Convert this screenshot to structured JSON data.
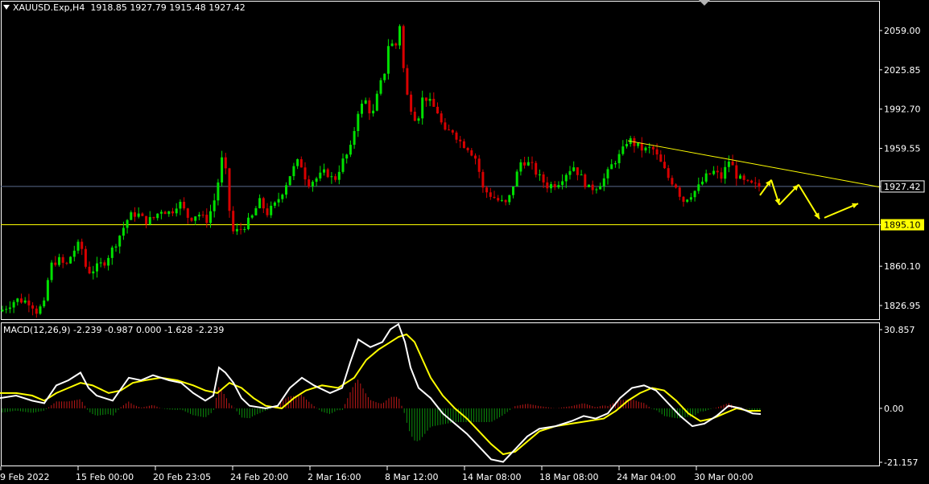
{
  "header": {
    "symbol": "XAUUSD.Exp,H4",
    "ohlc": "1918.85 1927.79 1915.48 1927.42"
  },
  "macd_header": {
    "label": "MACD(12,26,9) -2.239 -0.987 0.000 -1.628 -2.239"
  },
  "colors": {
    "background": "#000000",
    "bull_candle": "#00e000",
    "bear_candle": "#d80000",
    "macd_line": "#ffffff",
    "signal_line": "#ffff00",
    "histogram_up": "#c01818",
    "histogram_down": "#0c900c",
    "annotation": "#ffff00",
    "current_price_line": "#5a6a8c",
    "grid_frame": "#ffffff"
  },
  "chart_data": [
    {
      "type": "candlestick",
      "instrument": "XAUUSD.Exp",
      "timeframe": "H4",
      "ylim": [
        1800,
        2080
      ],
      "y_ticks": [
        "2059.00",
        "2025.85",
        "1992.70",
        "1959.55",
        "1927.42",
        "1895.10",
        "1860.10",
        "1826.95"
      ],
      "current_price": 1927.42,
      "support_level": 1895.1,
      "x_ticks": [
        "9 Feb 2022",
        "15 Feb 00:00",
        "20 Feb 23:05",
        "24 Feb 20:00",
        "2 Mar 16:00",
        "8 Mar 12:00",
        "14 Mar 08:00",
        "18 Mar 08:00",
        "24 Mar 04:00",
        "30 Mar 00:00"
      ],
      "close_path": [
        [
          0,
          1822
        ],
        [
          20,
          1832
        ],
        [
          38,
          1830
        ],
        [
          45,
          1822
        ],
        [
          55,
          1828
        ],
        [
          62,
          1860
        ],
        [
          72,
          1866
        ],
        [
          82,
          1860
        ],
        [
          90,
          1872
        ],
        [
          100,
          1880
        ],
        [
          108,
          1855
        ],
        [
          118,
          1858
        ],
        [
          130,
          1864
        ],
        [
          140,
          1875
        ],
        [
          150,
          1888
        ],
        [
          160,
          1902
        ],
        [
          170,
          1905
        ],
        [
          180,
          1898
        ],
        [
          190,
          1900
        ],
        [
          200,
          1908
        ],
        [
          212,
          1905
        ],
        [
          222,
          1915
        ],
        [
          235,
          1900
        ],
        [
          246,
          1905
        ],
        [
          256,
          1898
        ],
        [
          265,
          1912
        ],
        [
          272,
          1935
        ],
        [
          278,
          1960
        ],
        [
          283,
          1915
        ],
        [
          290,
          1888
        ],
        [
          300,
          1892
        ],
        [
          312,
          1900
        ],
        [
          322,
          1915
        ],
        [
          332,
          1905
        ],
        [
          342,
          1912
        ],
        [
          352,
          1925
        ],
        [
          362,
          1940
        ],
        [
          372,
          1950
        ],
        [
          382,
          1930
        ],
        [
          395,
          1935
        ],
        [
          405,
          1940
        ],
        [
          415,
          1932
        ],
        [
          425,
          1948
        ],
        [
          435,
          1958
        ],
        [
          445,
          1992
        ],
        [
          455,
          2000
        ],
        [
          462,
          1985
        ],
        [
          470,
          2008
        ],
        [
          478,
          2025
        ],
        [
          484,
          2055
        ],
        [
          490,
          2040
        ],
        [
          497,
          2066
        ],
        [
          503,
          2010
        ],
        [
          510,
          1995
        ],
        [
          518,
          1982
        ],
        [
          526,
          2005
        ],
        [
          534,
          1998
        ],
        [
          544,
          1990
        ],
        [
          552,
          1972
        ],
        [
          562,
          1975
        ],
        [
          572,
          1965
        ],
        [
          582,
          1960
        ],
        [
          592,
          1950
        ],
        [
          600,
          1925
        ],
        [
          610,
          1920
        ],
        [
          620,
          1915
        ],
        [
          630,
          1912
        ],
        [
          638,
          1930
        ],
        [
          648,
          1950
        ],
        [
          660,
          1945
        ],
        [
          670,
          1935
        ],
        [
          680,
          1928
        ],
        [
          692,
          1930
        ],
        [
          702,
          1938
        ],
        [
          712,
          1945
        ],
        [
          722,
          1935
        ],
        [
          732,
          1925
        ],
        [
          742,
          1928
        ],
        [
          752,
          1935
        ],
        [
          762,
          1948
        ],
        [
          772,
          1955
        ],
        [
          780,
          1968
        ],
        [
          790,
          1962
        ],
        [
          800,
          1958
        ],
        [
          810,
          1960
        ],
        [
          820,
          1948
        ],
        [
          830,
          1935
        ],
        [
          840,
          1928
        ],
        [
          848,
          1915
        ],
        [
          856,
          1920
        ],
        [
          866,
          1925
        ],
        [
          876,
          1935
        ],
        [
          886,
          1940
        ],
        [
          896,
          1935
        ],
        [
          906,
          1950
        ],
        [
          916,
          1935
        ],
        [
          926,
          1930
        ],
        [
          936,
          1928
        ],
        [
          944,
          1927.42
        ]
      ],
      "annotations": {
        "descending_trendline": {
          "start": {
            "x": "24 Mar 04:00",
            "price": 1966
          },
          "end": {
            "x": "forecast",
            "price": 1927
          }
        },
        "forecast_arrows": "zigzag projection from 1927.42: up to ~1934, down to ~1911, up to ~1929, down to ~1900, up to ~1912"
      }
    },
    {
      "type": "macd",
      "params": "12,26,9",
      "values": {
        "macd": -2.239,
        "signal": -0.987,
        "zero": 0.0,
        "hist_a": -1.628,
        "hist_b": -2.239
      },
      "ylim": [
        -21.157,
        30.857
      ],
      "y_ticks": [
        "30.857",
        "0.00",
        "-21.157"
      ],
      "macd_path": [
        [
          0,
          4
        ],
        [
          20,
          5
        ],
        [
          40,
          3
        ],
        [
          55,
          2
        ],
        [
          70,
          9
        ],
        [
          85,
          11
        ],
        [
          100,
          14
        ],
        [
          110,
          8
        ],
        [
          120,
          5
        ],
        [
          140,
          3
        ],
        [
          160,
          12
        ],
        [
          175,
          11
        ],
        [
          190,
          13
        ],
        [
          210,
          11
        ],
        [
          225,
          10
        ],
        [
          240,
          6
        ],
        [
          255,
          3
        ],
        [
          265,
          5
        ],
        [
          272,
          16
        ],
        [
          280,
          14
        ],
        [
          290,
          10
        ],
        [
          300,
          4
        ],
        [
          310,
          1
        ],
        [
          330,
          0
        ],
        [
          345,
          1
        ],
        [
          360,
          8
        ],
        [
          375,
          12
        ],
        [
          390,
          9
        ],
        [
          410,
          6
        ],
        [
          425,
          8
        ],
        [
          435,
          18
        ],
        [
          445,
          27
        ],
        [
          460,
          24
        ],
        [
          475,
          26
        ],
        [
          485,
          31
        ],
        [
          495,
          33
        ],
        [
          503,
          26
        ],
        [
          510,
          16
        ],
        [
          520,
          8
        ],
        [
          535,
          4
        ],
        [
          550,
          -2
        ],
        [
          565,
          -6
        ],
        [
          580,
          -10
        ],
        [
          595,
          -15
        ],
        [
          610,
          -20
        ],
        [
          625,
          -21
        ],
        [
          640,
          -16
        ],
        [
          655,
          -11
        ],
        [
          670,
          -8
        ],
        [
          690,
          -7
        ],
        [
          710,
          -5
        ],
        [
          725,
          -3
        ],
        [
          740,
          -4
        ],
        [
          755,
          -2
        ],
        [
          770,
          4
        ],
        [
          785,
          8
        ],
        [
          800,
          9
        ],
        [
          815,
          7
        ],
        [
          830,
          2
        ],
        [
          845,
          -3
        ],
        [
          860,
          -7
        ],
        [
          875,
          -6
        ],
        [
          890,
          -3
        ],
        [
          905,
          1
        ],
        [
          920,
          0
        ],
        [
          935,
          -2
        ],
        [
          945,
          -2.239
        ]
      ],
      "signal_path": [
        [
          0,
          6
        ],
        [
          20,
          6
        ],
        [
          40,
          5
        ],
        [
          55,
          3
        ],
        [
          70,
          6
        ],
        [
          85,
          8
        ],
        [
          100,
          10
        ],
        [
          115,
          9
        ],
        [
          135,
          6
        ],
        [
          150,
          7
        ],
        [
          165,
          10
        ],
        [
          180,
          11
        ],
        [
          200,
          12
        ],
        [
          220,
          11
        ],
        [
          240,
          9
        ],
        [
          255,
          7
        ],
        [
          270,
          6
        ],
        [
          285,
          10
        ],
        [
          300,
          8
        ],
        [
          315,
          4
        ],
        [
          330,
          1
        ],
        [
          350,
          0
        ],
        [
          365,
          4
        ],
        [
          380,
          7
        ],
        [
          400,
          9
        ],
        [
          420,
          8
        ],
        [
          440,
          12
        ],
        [
          455,
          19
        ],
        [
          470,
          23
        ],
        [
          485,
          26
        ],
        [
          495,
          28
        ],
        [
          505,
          29
        ],
        [
          515,
          26
        ],
        [
          525,
          19
        ],
        [
          535,
          12
        ],
        [
          550,
          5
        ],
        [
          565,
          0
        ],
        [
          580,
          -4
        ],
        [
          595,
          -9
        ],
        [
          610,
          -14
        ],
        [
          625,
          -18
        ],
        [
          640,
          -17
        ],
        [
          655,
          -13
        ],
        [
          670,
          -9
        ],
        [
          690,
          -7
        ],
        [
          710,
          -6
        ],
        [
          730,
          -5
        ],
        [
          750,
          -4
        ],
        [
          765,
          -1
        ],
        [
          780,
          3
        ],
        [
          795,
          6
        ],
        [
          810,
          8
        ],
        [
          825,
          7
        ],
        [
          840,
          3
        ],
        [
          855,
          -2
        ],
        [
          870,
          -5
        ],
        [
          885,
          -4
        ],
        [
          900,
          -2
        ],
        [
          915,
          0
        ],
        [
          930,
          -1
        ],
        [
          945,
          -0.987
        ]
      ]
    }
  ]
}
